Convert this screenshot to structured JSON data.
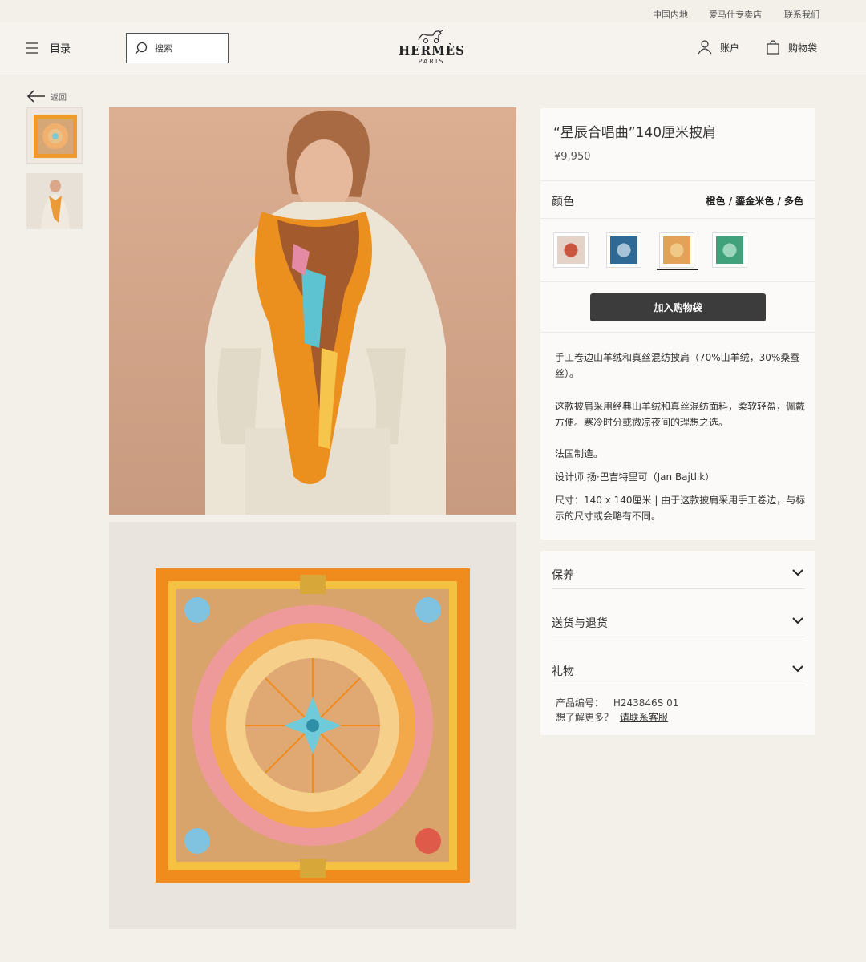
{
  "topbar": {
    "region": "中国内地",
    "stores": "爱马仕专卖店",
    "contact": "联系我们"
  },
  "header": {
    "menu_label": "目录",
    "search_placeholder": "搜索",
    "brand": "HERMÈS",
    "brand_city": "PARIS",
    "account_label": "账户",
    "bag_label": "购物袋"
  },
  "back_label": "返回",
  "product": {
    "title": "“星辰合唱曲”140厘米披肩",
    "price": "¥9,950",
    "color_label": "颜色",
    "color_value": "橙色 / 鎏金米色 / 多色",
    "swatches": [
      {
        "color": "#e6d3c8",
        "accent": "#c9553f"
      },
      {
        "color": "#2f6a96",
        "accent": "#a8c3d8"
      },
      {
        "color": "#e2a257",
        "accent": "#f0c987"
      },
      {
        "color": "#3fa27a",
        "accent": "#9cd6bc"
      }
    ],
    "add_to_bag": "加入购物袋",
    "desc1": "手工卷边山羊绒和真丝混纺披肩（70%山羊绒，30%桑蚕丝）。",
    "desc2": "这款披肩采用经典山羊绒和真丝混纺面料，柔软轻盈，佩戴方便。寒冷时分或微凉夜间的理想之选。",
    "desc3": "法国制造。",
    "desc4": "设计师 扬·巴吉特里可（Jan Bajtlik）",
    "desc5": "尺寸：140 x 140厘米 | 由于这款披肩采用手工卷边，与标示的尺寸或会略有不同。"
  },
  "accordions": {
    "care": "保养",
    "shipping": "送货与退货",
    "gift": "礼物"
  },
  "info": {
    "sku_label": "产品编号：",
    "sku": "H243846S 01",
    "more_label": "想了解更多？",
    "contact_link": "请联系客服"
  }
}
